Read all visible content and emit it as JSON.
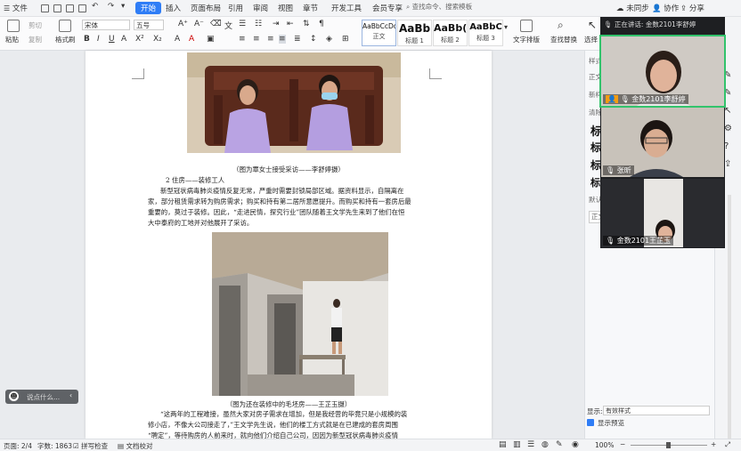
{
  "menubar": {
    "file": "文件",
    "items": [
      "开始",
      "插入",
      "页面布局",
      "引用",
      "审阅",
      "视图",
      "章节",
      "开发工具",
      "会员专享"
    ],
    "search_placeholder": "查找命令、搜索模板",
    "sync": "未同步",
    "collab": "协作",
    "share": "分享"
  },
  "ribbon": {
    "paste": "粘贴",
    "cut": "剪切",
    "copy": "复制",
    "format_painter": "格式刷",
    "font_name": "宋体",
    "font_size": "五号",
    "styles": [
      {
        "sample": "AaBbCcDd",
        "label": "正文"
      },
      {
        "sample": "AaBb",
        "label": "标题 1"
      },
      {
        "sample": "AaBb(",
        "label": "标题 2"
      },
      {
        "sample": "AaBbC",
        "label": "标题 3"
      }
    ],
    "text_layout": "文字排版",
    "find_replace": "查找替换",
    "select": "选择"
  },
  "doc": {
    "caption1": "（图为覃女士接受采访——李舒婷摄）",
    "heading2": "2 住房——装修工人",
    "para1": [
      "新型冠状病毒肺炎疫情反复无常，严重时需要封锁局部区域。据资料显示，自隔离在",
      "家，部分租赁需求转为购房需求；购买和持有第二居所意愿提升。而购买和持有一套房后最",
      "重要的，莫过于装修。因此，“走进民情，探究行业”团队随着王文学先生来到了他们在恒",
      "大中泰府的工地并对他展开了采访。"
    ],
    "caption2": "（图为还在装修中的毛坯房——王芷玉摄）",
    "para2": [
      "“这两年的工程难接，虽然大家对房子需求在增加，但是我经营的毕竟只是小规模的装",
      "修小店，不像大公司接走了，”王文学先生说，他们的楼工方式就是在已建成的套房周围",
      "“聘定”，等待购房的人前来时，就向他们介绍自己公司，因因为新型冠状病毒肺炎疫情"
    ]
  },
  "right_panel": {
    "items": [
      "样式",
      "正文",
      "新样",
      "清除",
      "标",
      "标",
      "标",
      "标",
      "默认",
      "正文"
    ],
    "show_label": "显示:",
    "show_value": "有效样式",
    "preview_label": "显示预览"
  },
  "video": {
    "speaking": "正在讲话: 金数2101李舒婷",
    "participants": [
      "金数2101李舒婷",
      "张昕",
      "金数2101王芷玉"
    ]
  },
  "assistant": {
    "text": "说点什么..."
  },
  "status": {
    "page": "页面: 2/4",
    "words": "字数: 1863",
    "spell": "拼写检查",
    "proof": "文档校对",
    "zoom": "100%"
  },
  "colors": {
    "accent": "#2f7df6",
    "video_bg": "#1e1f22",
    "active_border": "#32c36c"
  }
}
